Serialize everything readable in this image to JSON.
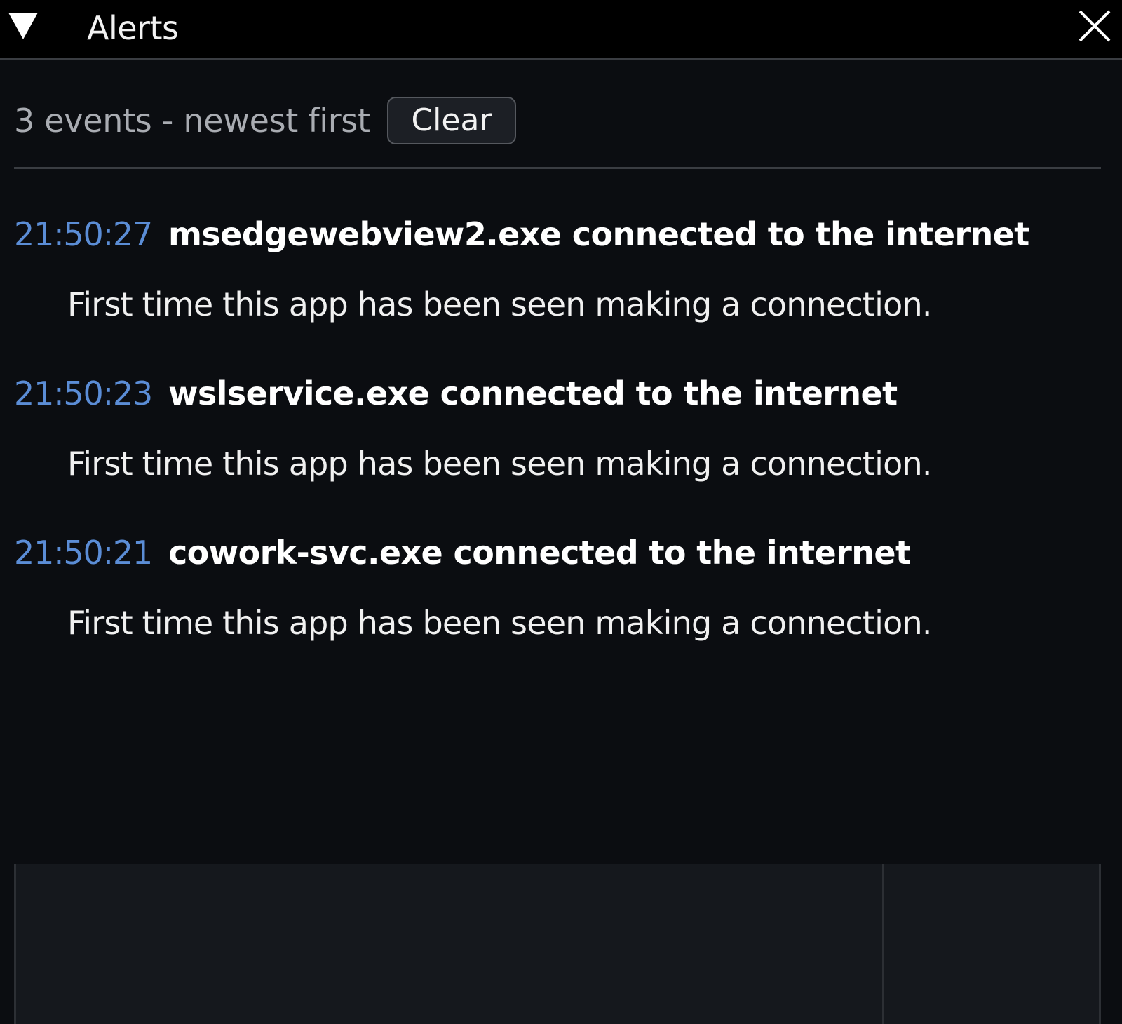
{
  "window": {
    "title": "Alerts",
    "collapse_icon": "triangle-down-icon",
    "close_icon": "close-icon"
  },
  "toolbar": {
    "event_count_label": "3 events - newest first",
    "clear_label": "Clear"
  },
  "events": [
    {
      "time": "21:50:27",
      "title": "msedgewebview2.exe connected to the internet",
      "description": "First time this app has been seen making a connection."
    },
    {
      "time": "21:50:23",
      "title": "wslservice.exe connected to the internet",
      "description": "First time this app has been seen making a connection."
    },
    {
      "time": "21:50:21",
      "title": "cowork-svc.exe connected to the internet",
      "description": "First time this app has been seen making a connection."
    }
  ],
  "colors": {
    "background": "#0b0d11",
    "titlebar": "#000000",
    "timestamp": "#5b8dd6",
    "muted_text": "#a9acb2",
    "panel": "#15181d"
  }
}
